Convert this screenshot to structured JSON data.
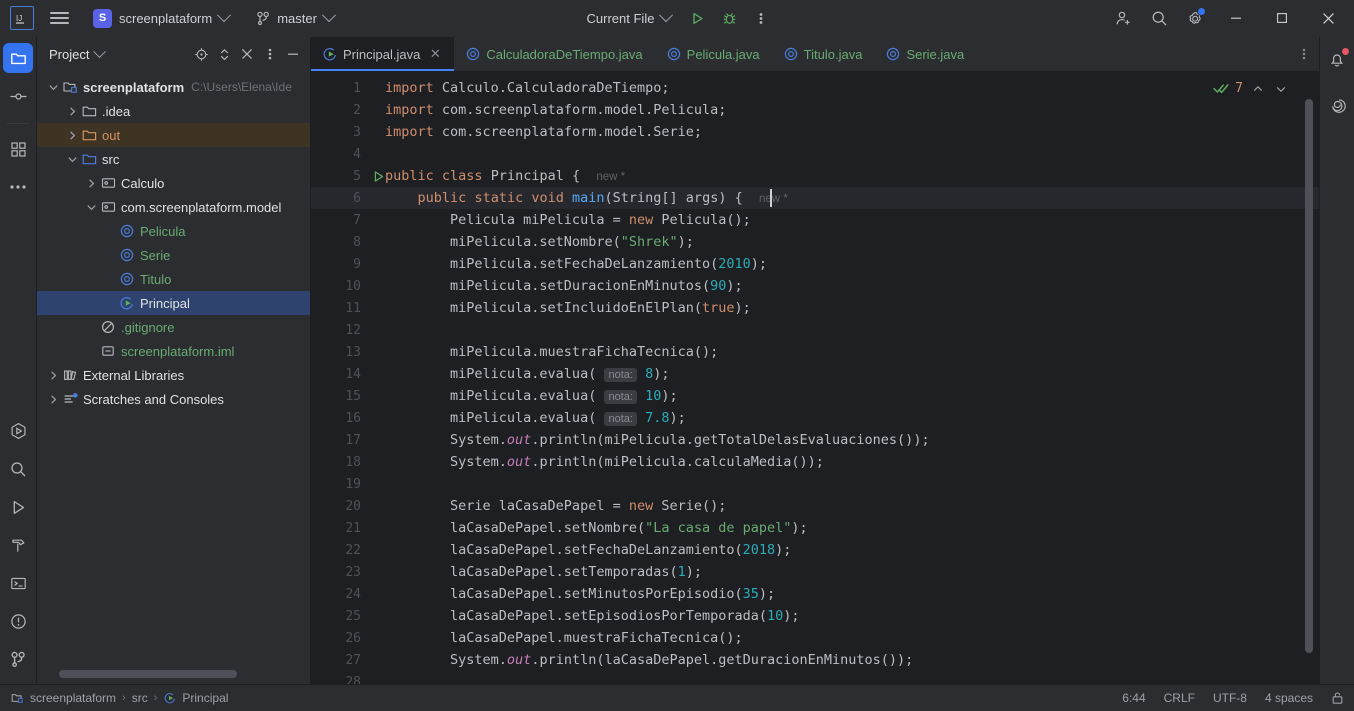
{
  "titlebar": {
    "logo_alt": "IJ",
    "menu_icon": "hamburger-icon",
    "project_initial": "S",
    "project_name": "screenplataform",
    "branch_icon": "vcs-branch-icon",
    "branch_name": "master",
    "run_config": "Current File",
    "run_icon": "run-icon",
    "debug_icon": "debug-icon",
    "more_icon": "more-vertical-icon",
    "account_icon": "add-user-icon",
    "search_icon": "search-icon",
    "settings_icon": "gear-icon",
    "minimize": "–",
    "maximize": "□",
    "close": "✕"
  },
  "left_rail": [
    {
      "name": "project-tool-button",
      "icon": "folder-icon",
      "active": true
    },
    {
      "name": "commit-tool-button",
      "icon": "commit-node-icon",
      "active": false
    },
    {
      "name": "structure-tool-button",
      "icon": "grid-squares-icon",
      "active": false
    },
    {
      "name": "more-tool-windows-button",
      "icon": "ellipsis-icon",
      "active": false
    },
    {
      "name": "run-anything-button",
      "icon": "hex-run-icon",
      "active": false
    },
    {
      "name": "find-button",
      "icon": "search-icon",
      "active": false
    },
    {
      "name": "run-tool-button",
      "icon": "play-icon",
      "active": false
    },
    {
      "name": "build-tool-button",
      "icon": "hammer-icon",
      "active": false
    },
    {
      "name": "terminal-tool-button",
      "icon": "terminal-icon",
      "active": false
    },
    {
      "name": "problems-tool-button",
      "icon": "warning-circle-icon",
      "active": false
    },
    {
      "name": "version-control-button",
      "icon": "vcs-branch-icon",
      "active": false
    }
  ],
  "right_rail": [
    {
      "name": "notifications-button",
      "icon": "bell-icon",
      "badge": true
    },
    {
      "name": "ai-assistant-button",
      "icon": "spiral-icon",
      "badge": false
    }
  ],
  "project_panel": {
    "title": "Project",
    "title_chevron": "chevron-down-icon",
    "actions": [
      {
        "name": "select-opened-file-button",
        "icon": "crosshair-icon"
      },
      {
        "name": "expand-collapse-button",
        "icon": "updown-chevrons-icon"
      },
      {
        "name": "collapse-all-button",
        "icon": "collapse-icon"
      },
      {
        "name": "panel-options-button",
        "icon": "more-vertical-icon"
      },
      {
        "name": "hide-panel-button",
        "icon": "minimize-icon"
      }
    ],
    "tree": [
      {
        "label": "screenplataform",
        "path": "C:\\Users\\Elena\\Ide",
        "depth": 0,
        "toggle": "expanded",
        "icon": "module-icon",
        "color": "default",
        "state": "normal",
        "bold": true
      },
      {
        "label": ".idea",
        "path": "",
        "depth": 1,
        "toggle": "collapsed",
        "icon": "folder-icon",
        "color": "default",
        "state": "normal",
        "bold": false
      },
      {
        "label": "out",
        "path": "",
        "depth": 1,
        "toggle": "collapsed",
        "icon": "folder-orange-icon",
        "color": "orange",
        "state": "highlighted",
        "bold": false
      },
      {
        "label": "src",
        "path": "",
        "depth": 1,
        "toggle": "expanded",
        "icon": "folder-blue-icon",
        "color": "default",
        "state": "normal",
        "bold": false
      },
      {
        "label": "Calculo",
        "path": "",
        "depth": 2,
        "toggle": "collapsed",
        "icon": "package-icon",
        "color": "default",
        "state": "normal",
        "bold": false
      },
      {
        "label": "com.screenplataform.model",
        "path": "",
        "depth": 2,
        "toggle": "expanded",
        "icon": "package-icon",
        "color": "default",
        "state": "normal",
        "bold": false
      },
      {
        "label": "Pelicula",
        "path": "",
        "depth": 3,
        "toggle": "none",
        "icon": "java-class-icon",
        "color": "green",
        "state": "normal",
        "bold": false
      },
      {
        "label": "Serie",
        "path": "",
        "depth": 3,
        "toggle": "none",
        "icon": "java-class-icon",
        "color": "green",
        "state": "normal",
        "bold": false
      },
      {
        "label": "Titulo",
        "path": "",
        "depth": 3,
        "toggle": "none",
        "icon": "java-class-icon",
        "color": "green",
        "state": "normal",
        "bold": false
      },
      {
        "label": "Principal",
        "path": "",
        "depth": 3,
        "toggle": "none",
        "icon": "java-runnable-class-icon",
        "color": "default",
        "state": "selected",
        "bold": false
      },
      {
        "label": ".gitignore",
        "path": "",
        "depth": 2,
        "toggle": "none",
        "icon": "gitignore-icon",
        "color": "green",
        "state": "normal",
        "bold": false
      },
      {
        "label": "screenplataform.iml",
        "path": "",
        "depth": 2,
        "toggle": "none",
        "icon": "iml-file-icon",
        "color": "green",
        "state": "normal",
        "bold": false
      },
      {
        "label": "External Libraries",
        "path": "",
        "depth": 0,
        "toggle": "collapsed",
        "icon": "libraries-icon",
        "color": "default",
        "state": "normal",
        "bold": false
      },
      {
        "label": "Scratches and Consoles",
        "path": "",
        "depth": 0,
        "toggle": "collapsed",
        "icon": "scratches-icon",
        "color": "default",
        "state": "normal",
        "bold": false
      }
    ]
  },
  "editor": {
    "tabs": [
      {
        "label": "Principal.java",
        "icon": "java-runnable-class-icon",
        "active": true,
        "closable": true
      },
      {
        "label": "CalculadoraDeTiempo.java",
        "icon": "java-class-icon",
        "active": false,
        "closable": false
      },
      {
        "label": "Pelicula.java",
        "icon": "java-class-icon",
        "active": false,
        "closable": false
      },
      {
        "label": "Titulo.java",
        "icon": "java-class-icon",
        "active": false,
        "closable": false
      },
      {
        "label": "Serie.java",
        "icon": "java-class-icon",
        "active": false,
        "closable": false
      }
    ],
    "tabs_more_icon": "more-vertical-icon",
    "inspection": {
      "status_icon": "double-check-icon",
      "count": "7",
      "prev_icon": "chevron-up-icon",
      "next_icon": "chevron-down-icon"
    },
    "current_line": 6,
    "first_line": 1,
    "last_line": 28,
    "run_gutter_lines": [
      5,
      6
    ],
    "code_lines": [
      "import Calculo.CalculadoraDeTiempo;",
      "import com.screenplataform.model.Pelicula;",
      "import com.screenplataform.model.Serie;",
      "",
      "public class Principal {  new *",
      "    public static void main(String[] args) {  new *",
      "        Pelicula miPelicula = new Pelicula();",
      "        miPelicula.setNombre(\"Shrek\");",
      "        miPelicula.setFechaDeLanzamiento(2010);",
      "        miPelicula.setDuracionEnMinutos(90);",
      "        miPelicula.setIncluidoEnElPlan(true);",
      "",
      "        miPelicula.muestraFichaTecnica();",
      "        miPelicula.evalua( nota: 8);",
      "        miPelicula.evalua( nota: 10);",
      "        miPelicula.evalua( nota: 7.8);",
      "        System.out.println(miPelicula.getTotalDelasEvaluaciones());",
      "        System.out.println(miPelicula.calculaMedia());",
      "",
      "        Serie laCasaDePapel = new Serie();",
      "        laCasaDePapel.setNombre(\"La casa de papel\");",
      "        laCasaDePapel.setFechaDeLanzamiento(2018);",
      "        laCasaDePapel.setTemporadas(1);",
      "        laCasaDePapel.setMinutosPorEpisodio(35);",
      "        laCasaDePapel.setEpisodiosPorTemporada(10);",
      "        laCasaDePapel.muestraFichaTecnica();",
      "        System.out.println(laCasaDePapel.getDuracionEnMinutos());",
      ""
    ]
  },
  "status_bar": {
    "breadcrumbs": [
      {
        "label": "screenplataform",
        "icon": "module-icon"
      },
      {
        "label": "src",
        "icon": "none"
      },
      {
        "label": "Principal",
        "icon": "java-runnable-class-icon"
      }
    ],
    "separator": "›",
    "caret_position": "6:44",
    "line_separator": "CRLF",
    "encoding": "UTF-8",
    "indent": "4 spaces",
    "lock_icon": "lock-icon"
  },
  "colors": {
    "accent": "#3574f0",
    "keyword": "#cf8e6d",
    "string": "#6aab73",
    "number": "#2aacb8",
    "method": "#56a8f5",
    "field": "#c77dbb",
    "selection": "#2e436e",
    "highlight": "#3f3424",
    "editor_bg": "#1e1f22",
    "panel_bg": "#2b2d30"
  }
}
